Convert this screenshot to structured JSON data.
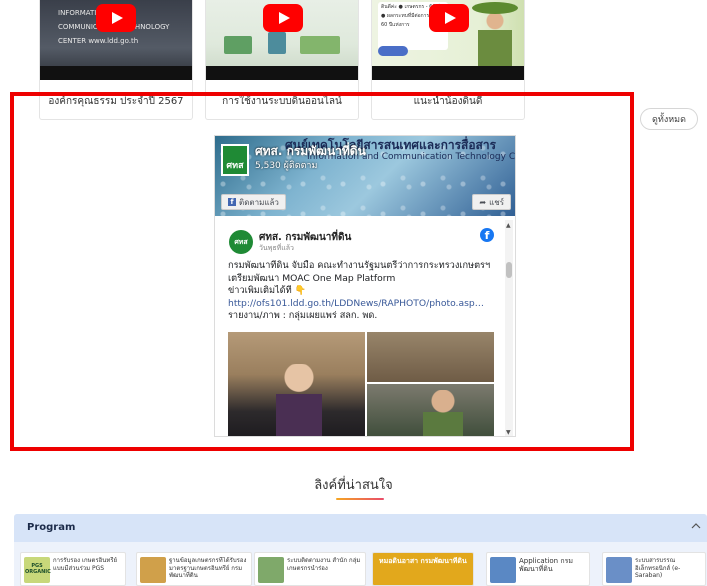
{
  "videos": [
    {
      "title": "องค์กรคุณธรรม ประจำปี 2567",
      "thumb_text": "INFORMATION AND COMMUNICATION TECHNOLOGY CENTER  www.ldd.go.th"
    },
    {
      "title": "การใช้งานระบบดินออนไลน์"
    },
    {
      "title": "แนะนำน้องดินดี",
      "thumb_text": "ดินดีค่ะ  ● เกษตรกร - 60 ปี  ● ผลกระทบที่มีต่อการ  ใช้ดิน 60 ปีแห่งการ"
    }
  ],
  "see_all_label": "ดูทั้งหมด",
  "fb_widget": {
    "cover_banner": "ศูนย์เทคโนโลยีสารสนเทศและการสื่อสาร",
    "cover_banner_en": "Information and Communication Technology Center",
    "page_name": "ศทส. กรมพัฒนาที่ดิน",
    "followers": "5,530 ผู้ติดตาม",
    "logo_text": "ศทส",
    "follow_label": "ติดตามแล้ว",
    "share_label": "แชร์",
    "post": {
      "author": "ศทส. กรมพัฒนาที่ดิน",
      "time": "วันพุธที่แล้ว",
      "lines": [
        "กรมพัฒนาที่ดิน จับมือ คณะทำงานรัฐมนตรีว่าการกระทรวงเกษตรฯ",
        "เตรียมพัฒนา MOAC One Map Platform",
        "ข่าวเพิ่มเติมได้ที่ 👇",
        "http://ofs101.ldd.go.th/LDDNews/RAPHOTO/photo.asp…",
        "รายงาน/ภาพ : กลุ่มเผยแพร่ สลก. พด."
      ]
    }
  },
  "links_section": {
    "title": "ลิงค์ที่น่าสนใจ",
    "program_label": "Program",
    "items": [
      {
        "text": "การรับรอง เกษตรอินทรีย์ แบบมีส่วนร่วม PGS",
        "icon_text": "PGS ORGANIC",
        "color": "#c8d87a"
      },
      {
        "text": "ฐานข้อมูลเกษตรกรที่ได้รับรอง มาตรฐานเกษตรอินทรีย์ กรมพัฒนาที่ดิน",
        "color": "#d0a04a"
      },
      {
        "text": "ระบบติดตามงาน สำนัก กลุ่มเกษตรกรนำร่อง",
        "color": "#7fa96a"
      },
      {
        "text": "หมอดินอาสา กรมพัฒนาที่ดิน",
        "color": "#e2a81c"
      },
      {
        "text": "Application กรมพัฒนาที่ดิน",
        "color": "#5a88c4"
      },
      {
        "text": "ระบบสารบรรณ อิเล็กทรอนิกส์ (e-Saraban)",
        "color": "#6a8fc7"
      }
    ]
  }
}
